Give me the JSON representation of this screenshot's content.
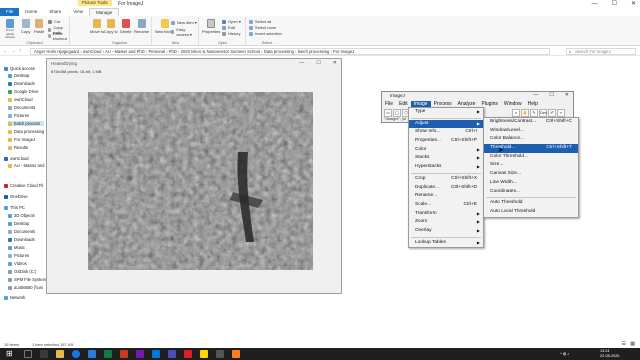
{
  "explorer": {
    "title": "For ImageJ",
    "context_tab": "Picture Tools",
    "window_controls": [
      "—",
      "☐",
      "✕"
    ],
    "tabs": [
      "File",
      "Home",
      "Share",
      "View",
      "Manage"
    ],
    "ribbon": {
      "clipboard": {
        "label": "Clipboard",
        "pin": "Pin to Quick access",
        "copy": "Copy",
        "paste": "Paste",
        "cut": "Cut",
        "copy_path": "Copy path",
        "paste_shortcut": "Paste shortcut"
      },
      "organize": {
        "label": "Organize",
        "move_to": "Move to",
        "copy_to": "Copy to",
        "delete": "Delete",
        "rename": "Rename"
      },
      "new": {
        "label": "New",
        "new_folder": "New folder",
        "new_item": "New item ▾",
        "easy_access": "Easy access ▾"
      },
      "open": {
        "label": "Open",
        "properties": "Properties",
        "open": "Open ▾",
        "edit": "Edit",
        "history": "History"
      },
      "select": {
        "label": "Select",
        "select_all": "Select all",
        "select_none": "Select none",
        "invert": "Invert selection"
      }
    },
    "address": "Anger Holm Hjøgegaard  ›  ownCloud  ›  AU - Master and PhD  ›  Personal  ›  PhD  ›  2020 Micro & Nanosensor Summer School  ›  Data processing  ›  batch processing  ›  For ImageJ",
    "search_placeholder": "Search For ImageJ",
    "nav_items": [
      "Quick access",
      "Desktop",
      "Downloads",
      "Google Drive",
      "ownCloud",
      "Documents",
      "Pictures",
      "batch process",
      "Data processing",
      "For ImageJ",
      "Results",
      "ownCloud",
      "AU - Master and",
      "Creative Cloud Fil",
      "OneDrive",
      "This PC",
      "3D Objects",
      "Desktop",
      "Documents",
      "Downloads",
      "Music",
      "Pictures",
      "Videos",
      "OSDisk (C:)",
      "SPM File System",
      "au456680 (\\\\uni",
      "Network"
    ],
    "status": {
      "items": "15 items",
      "selected": "1 item selected  157 KB"
    }
  },
  "taskbar": {
    "time": "13:24",
    "date": "22-08-2020"
  },
  "image_window": {
    "title": "HeatedDying",
    "info": "675x458 pixels; 16-bit; 1 MB",
    "controls": [
      "—",
      "☐",
      "✕"
    ]
  },
  "imagej": {
    "title": "ImageJ",
    "controls": [
      "—",
      "☐",
      "✕"
    ],
    "menus": [
      "File",
      "Edit",
      "Image",
      "Process",
      "Analyze",
      "Plugins",
      "Window",
      "Help"
    ],
    "status": "\"Straight\"; (st"
  },
  "image_menu": [
    {
      "label": "Type",
      "shortcut": "",
      "submenu": true
    },
    {
      "sep": true
    },
    {
      "label": "Adjust",
      "shortcut": "",
      "submenu": true,
      "highlight": true
    },
    {
      "label": "Show Info...",
      "shortcut": "Ctrl+I"
    },
    {
      "label": "Properties...",
      "shortcut": "Ctrl+Shift+P"
    },
    {
      "label": "Color",
      "shortcut": "",
      "submenu": true
    },
    {
      "label": "Stacks",
      "shortcut": "",
      "submenu": true
    },
    {
      "label": "Hyperstacks",
      "shortcut": "",
      "submenu": true
    },
    {
      "sep": true
    },
    {
      "label": "Crop",
      "shortcut": "Ctrl+Shift+X"
    },
    {
      "label": "Duplicate...",
      "shortcut": "Ctrl+Shift+D"
    },
    {
      "label": "Rename...",
      "shortcut": ""
    },
    {
      "label": "Scale...",
      "shortcut": "Ctrl+E"
    },
    {
      "label": "Transform",
      "shortcut": "",
      "submenu": true
    },
    {
      "label": "Zoom",
      "shortcut": "",
      "submenu": true
    },
    {
      "label": "Overlay",
      "shortcut": "",
      "submenu": true
    },
    {
      "sep": true
    },
    {
      "label": "Lookup Tables",
      "shortcut": "",
      "submenu": true
    }
  ],
  "adjust_menu": [
    {
      "label": "Brightness/Contrast...",
      "shortcut": "Ctrl+Shift+C"
    },
    {
      "label": "Window/Level...",
      "shortcut": ""
    },
    {
      "label": "Color Balance...",
      "shortcut": ""
    },
    {
      "label": "Threshold...",
      "shortcut": "Ctrl+Shift+T",
      "highlight": true
    },
    {
      "label": "Color Threshold...",
      "shortcut": ""
    },
    {
      "label": "Size...",
      "shortcut": ""
    },
    {
      "label": "Canvas Size...",
      "shortcut": ""
    },
    {
      "label": "Line Width...",
      "shortcut": ""
    },
    {
      "label": "Coordinates...",
      "shortcut": ""
    },
    {
      "sep": true
    },
    {
      "label": "Auto Threshold",
      "shortcut": ""
    },
    {
      "label": "Auto Local Threshold",
      "shortcut": ""
    }
  ]
}
